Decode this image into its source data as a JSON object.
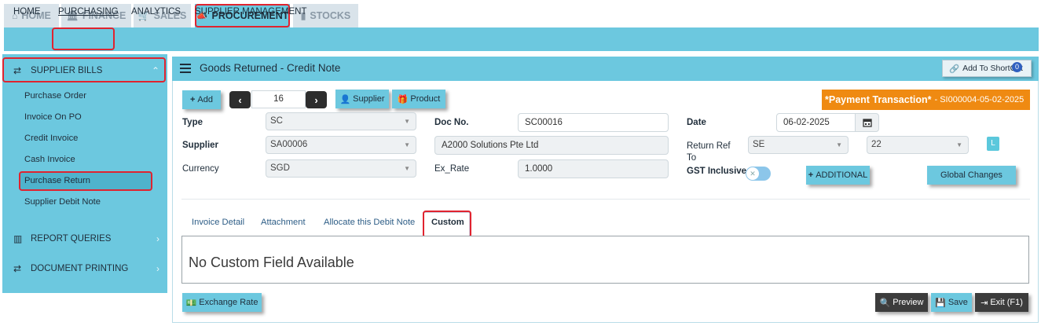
{
  "top_tabs": [
    {
      "label": "HOME",
      "icon": "home-icon"
    },
    {
      "label": "FINANCE",
      "icon": "bank-icon"
    },
    {
      "label": "SALES",
      "icon": "cart-icon"
    },
    {
      "label": "PROCUREMENT",
      "icon": "bullhorn-icon"
    },
    {
      "label": "STOCKS",
      "icon": "bar-chart-icon"
    }
  ],
  "sub_nav": [
    "HOME",
    "PURCHASING",
    "ANALYTICS",
    "SUPPLIER MANAGEMENT"
  ],
  "sidebar": {
    "section1": "SUPPLIER BILLS",
    "items": [
      "Purchase Order",
      "Invoice On PO",
      "Credit Invoice",
      "Cash Invoice",
      "Purchase Return",
      "Supplier Debit Note"
    ],
    "section2": "REPORT QUERIES",
    "section3": "DOCUMENT PRINTING"
  },
  "panel": {
    "title": "Goods Returned - Credit Note",
    "shortcut_label": "Add To ShortCut",
    "shortcut_count": "0"
  },
  "toolbar": {
    "add": "Add",
    "record_number": "16",
    "supplier": "Supplier",
    "product": "Product"
  },
  "payment_banner": {
    "title": "*Payment Transaction*",
    "ref": "- SI000004-05-02-2025"
  },
  "form": {
    "type_label": "Type",
    "type_value": "SC",
    "supplier_label": "Supplier",
    "supplier_value": "SA00006",
    "currency_label": "Currency",
    "currency_value": "SGD",
    "docno_label": "Doc No.",
    "docno_value": "SC00016",
    "supplier_name": "A2000 Solutions Pte Ltd",
    "exrate_label": "Ex_Rate",
    "exrate_value": "1.0000",
    "date_label": "Date",
    "date_value": "06-02-2025",
    "returnref_label_1": "Return Ref",
    "returnref_label_2": "To",
    "returnref_value": "SE",
    "returnref_number": "22",
    "gst_label": "GST Inclusive",
    "gst_toggle_mark": "✕",
    "l_badge": "L",
    "additional": "ADDITIONAL",
    "global_changes": "Global Changes"
  },
  "tabs": [
    "Invoice Detail",
    "Attachment",
    "Allocate this Debit Note",
    "Custom"
  ],
  "custom_message": "No Custom Field Available",
  "footer": {
    "exchange_rate": "Exchange Rate",
    "preview": "Preview",
    "save": "Save",
    "exit": "Exit (F1)"
  },
  "colors": {
    "accent": "#6cc8df",
    "tab_inactive": "#d9e3ea",
    "banner": "#ef8a12",
    "highlight": "#e0232f"
  }
}
